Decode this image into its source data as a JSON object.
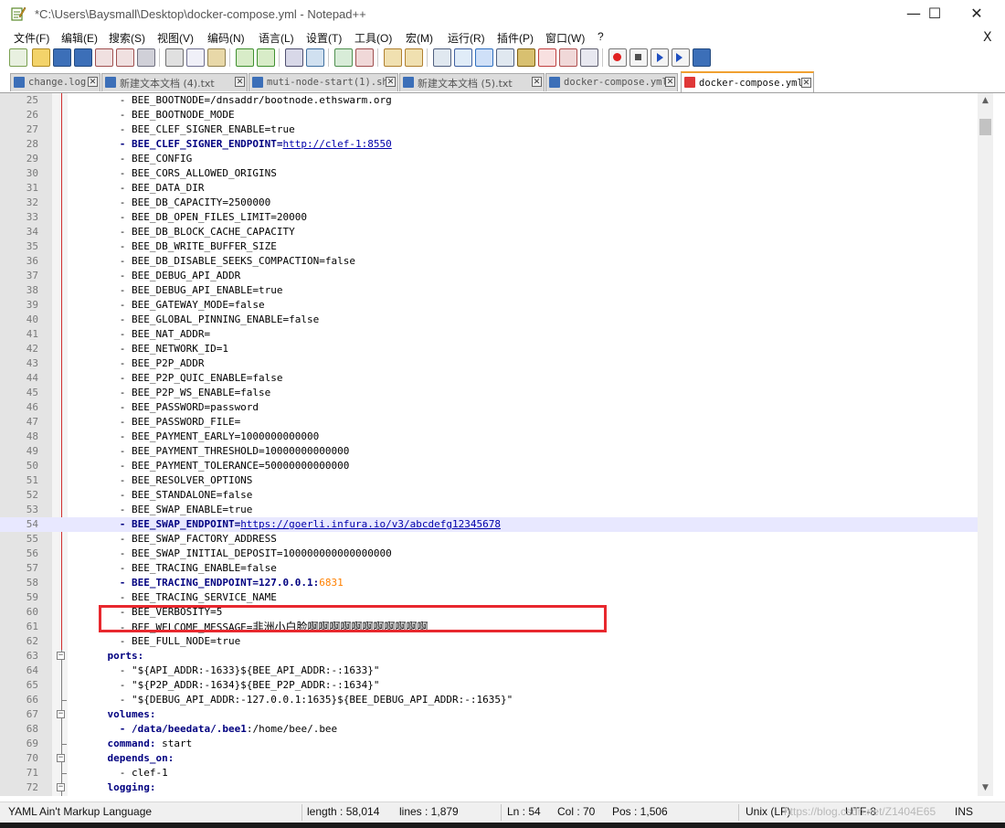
{
  "window": {
    "title": "*C:\\Users\\Baysmall\\Desktop\\docker-compose.yml - Notepad++",
    "app_icon": "notepad-plus-plus-icon",
    "controls": {
      "minimize": "—",
      "maximize": "☐",
      "close": "✕"
    }
  },
  "menu": {
    "items": [
      "文件(F)",
      "编辑(E)",
      "搜索(S)",
      "视图(V)",
      "编码(N)",
      "语言(L)",
      "设置(T)",
      "工具(O)",
      "宏(M)",
      "运行(R)",
      "插件(P)",
      "窗口(W)",
      "?"
    ],
    "close_doc": "X"
  },
  "toolbar": {
    "icons": [
      "new-file-icon",
      "open-file-icon",
      "save-icon",
      "save-all-icon",
      "close-icon",
      "close-all-icon",
      "print-icon",
      "cut-icon",
      "copy-icon",
      "paste-icon",
      "undo-icon",
      "redo-icon",
      "find-icon",
      "replace-icon",
      "zoom-in-icon",
      "zoom-out-icon",
      "sync-v-icon",
      "sync-h-icon",
      "word-wrap-icon",
      "show-all-chars-icon",
      "indent-guide-icon",
      "language-icon",
      "document-map-icon",
      "function-list-icon",
      "folder-workspace-icon",
      "monitor-icon",
      "record-macro-icon",
      "stop-record-icon",
      "play-macro-icon",
      "play-multiple-icon",
      "save-macro-icon"
    ]
  },
  "tabs": [
    {
      "label": "change.log",
      "icon": "save-icon",
      "active": false
    },
    {
      "label": "新建文本文档 (4).txt",
      "icon": "save-icon",
      "active": false
    },
    {
      "label": "muti-node-start(1).sh",
      "icon": "save-icon",
      "active": false
    },
    {
      "label": "新建文本文档 (5).txt",
      "icon": "save-icon",
      "active": false
    },
    {
      "label": "docker-compose.yml",
      "icon": "save-icon",
      "active": false
    },
    {
      "label": "docker-compose.yml",
      "icon": "unsaved-icon",
      "active": true
    }
  ],
  "editor": {
    "current_line": 54,
    "lines": [
      {
        "n": "25",
        "t": "      - BEE_BOOTNODE=/dnsaddr/bootnode.ethswarm.org"
      },
      {
        "n": "26",
        "t": "      - BEE_BOOTNODE_MODE"
      },
      {
        "n": "27",
        "t": "      - BEE_CLEF_SIGNER_ENABLE=true"
      },
      {
        "n": "28",
        "t": "      - BEE_CLEF_SIGNER_ENDPOINT=http://clef-1:8550"
      },
      {
        "n": "29",
        "t": "      - BEE_CONFIG"
      },
      {
        "n": "30",
        "t": "      - BEE_CORS_ALLOWED_ORIGINS"
      },
      {
        "n": "31",
        "t": "      - BEE_DATA_DIR"
      },
      {
        "n": "32",
        "t": "      - BEE_DB_CAPACITY=2500000"
      },
      {
        "n": "33",
        "t": "      - BEE_DB_OPEN_FILES_LIMIT=20000"
      },
      {
        "n": "34",
        "t": "      - BEE_DB_BLOCK_CACHE_CAPACITY"
      },
      {
        "n": "35",
        "t": "      - BEE_DB_WRITE_BUFFER_SIZE"
      },
      {
        "n": "36",
        "t": "      - BEE_DB_DISABLE_SEEKS_COMPACTION=false"
      },
      {
        "n": "37",
        "t": "      - BEE_DEBUG_API_ADDR"
      },
      {
        "n": "38",
        "t": "      - BEE_DEBUG_API_ENABLE=true"
      },
      {
        "n": "39",
        "t": "      - BEE_GATEWAY_MODE=false"
      },
      {
        "n": "40",
        "t": "      - BEE_GLOBAL_PINNING_ENABLE=false"
      },
      {
        "n": "41",
        "t": "      - BEE_NAT_ADDR="
      },
      {
        "n": "42",
        "t": "      - BEE_NETWORK_ID=1"
      },
      {
        "n": "43",
        "t": "      - BEE_P2P_ADDR"
      },
      {
        "n": "44",
        "t": "      - BEE_P2P_QUIC_ENABLE=false"
      },
      {
        "n": "45",
        "t": "      - BEE_P2P_WS_ENABLE=false"
      },
      {
        "n": "46",
        "t": "      - BEE_PASSWORD=password"
      },
      {
        "n": "47",
        "t": "      - BEE_PASSWORD_FILE="
      },
      {
        "n": "48",
        "t": "      - BEE_PAYMENT_EARLY=1000000000000"
      },
      {
        "n": "49",
        "t": "      - BEE_PAYMENT_THRESHOLD=10000000000000"
      },
      {
        "n": "50",
        "t": "      - BEE_PAYMENT_TOLERANCE=50000000000000"
      },
      {
        "n": "51",
        "t": "      - BEE_RESOLVER_OPTIONS"
      },
      {
        "n": "52",
        "t": "      - BEE_STANDALONE=false"
      },
      {
        "n": "53",
        "t": "      - BEE_SWAP_ENABLE=true"
      },
      {
        "n": "54",
        "t": "      - BEE_SWAP_ENDPOINT=https://goerli.infura.io/v3/abcdefg12345678"
      },
      {
        "n": "55",
        "t": "      - BEE_SWAP_FACTORY_ADDRESS"
      },
      {
        "n": "56",
        "t": "      - BEE_SWAP_INITIAL_DEPOSIT=100000000000000000"
      },
      {
        "n": "57",
        "t": "      - BEE_TRACING_ENABLE=false"
      },
      {
        "n": "58",
        "t": "      - BEE_TRACING_ENDPOINT=127.0.0.1:6831"
      },
      {
        "n": "59",
        "t": "      - BEE_TRACING_SERVICE_NAME"
      },
      {
        "n": "60",
        "t": "      - BEE_VERBOSITY=5"
      },
      {
        "n": "61",
        "t": "      - BEE_WELCOME_MESSAGE=非洲小白脸啊啊啊啊啊啊啊啊啊啊啊"
      },
      {
        "n": "62",
        "t": "      - BEE_FULL_NODE=true"
      },
      {
        "n": "63",
        "t": "    ports:"
      },
      {
        "n": "64",
        "t": "      - \"${API_ADDR:-1633}${BEE_API_ADDR:-:1633}\""
      },
      {
        "n": "65",
        "t": "      - \"${P2P_ADDR:-1634}${BEE_P2P_ADDR:-:1634}\""
      },
      {
        "n": "66",
        "t": "      - \"${DEBUG_API_ADDR:-127.0.0.1:1635}${BEE_DEBUG_API_ADDR:-:1635}\""
      },
      {
        "n": "67",
        "t": "    volumes:"
      },
      {
        "n": "68",
        "t": "      - /data/beedata/.bee1:/home/bee/.bee"
      },
      {
        "n": "69",
        "t": "    command: start"
      },
      {
        "n": "70",
        "t": "    depends_on:"
      },
      {
        "n": "71",
        "t": "      - clef-1"
      },
      {
        "n": "72",
        "t": "    logging:"
      }
    ]
  },
  "status": {
    "language": "YAML Ain't Markup Language",
    "length": "length : 58,014",
    "lines": "lines : 1,879",
    "ln": "Ln : 54",
    "col": "Col : 70",
    "pos": "Pos : 1,506",
    "eol": "Unix (LF)",
    "encoding": "UTF-8",
    "mode": "INS",
    "watermark": "https://blog.csdn.net/Z1404E65"
  }
}
